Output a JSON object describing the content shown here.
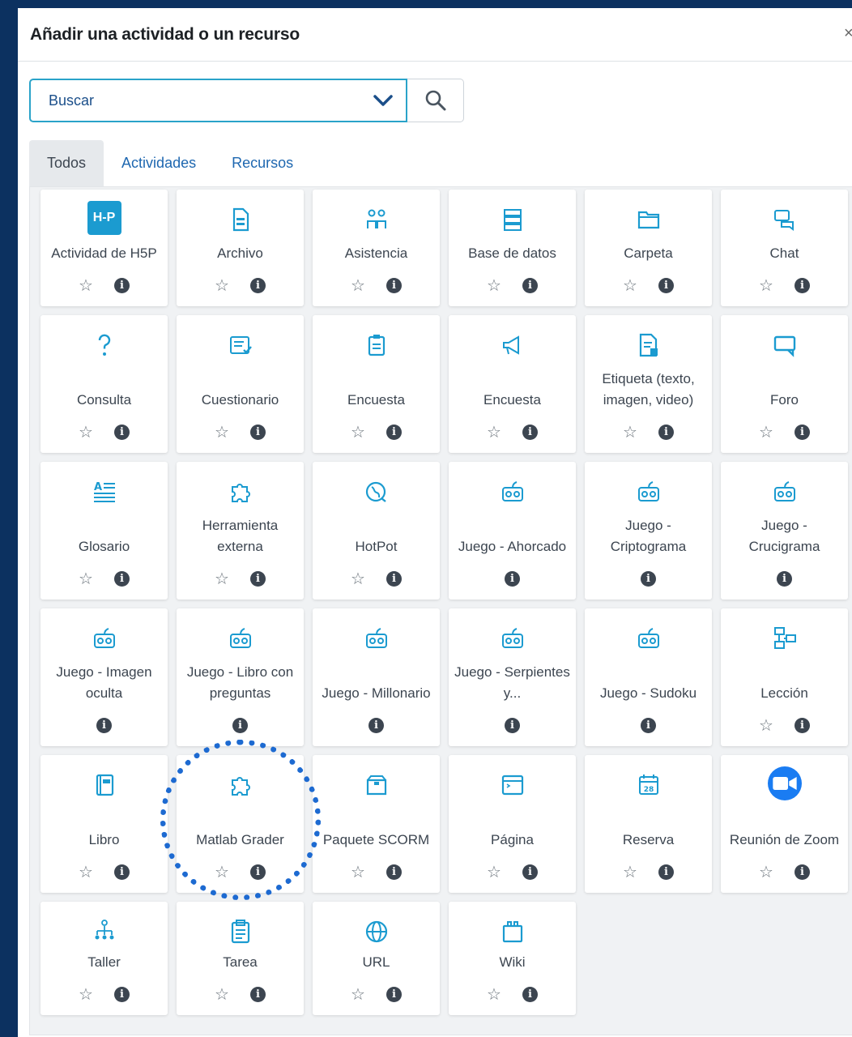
{
  "modal": {
    "title": "Añadir una actividad o un recurso",
    "close": "×"
  },
  "search": {
    "placeholder": "Buscar"
  },
  "tabs": [
    {
      "label": "Todos",
      "active": true
    },
    {
      "label": "Actividades",
      "active": false
    },
    {
      "label": "Recursos",
      "active": false
    }
  ],
  "items": [
    {
      "label": "Actividad de H5P",
      "icon": "h5p-icon",
      "starred": false
    },
    {
      "label": "Archivo",
      "icon": "file-icon",
      "starred": false
    },
    {
      "label": "Asistencia",
      "icon": "attendance-icon",
      "starred": false
    },
    {
      "label": "Base de datos",
      "icon": "database-icon",
      "starred": false
    },
    {
      "label": "Carpeta",
      "icon": "folder-icon",
      "starred": false
    },
    {
      "label": "Chat",
      "icon": "chat-icon",
      "starred": false
    },
    {
      "label": "Consulta",
      "icon": "question-icon",
      "starred": false
    },
    {
      "label": "Cuestionario",
      "icon": "quiz-icon",
      "starred": false
    },
    {
      "label": "Encuesta",
      "icon": "clipboard-icon",
      "starred": false
    },
    {
      "label": "Encuesta",
      "icon": "megaphone-icon",
      "starred": false
    },
    {
      "label": "Etiqueta (texto, imagen, video)",
      "icon": "label-icon",
      "starred": false
    },
    {
      "label": "Foro",
      "icon": "forum-icon",
      "starred": false
    },
    {
      "label": "Glosario",
      "icon": "glossary-icon",
      "starred": false
    },
    {
      "label": "Herramienta externa",
      "icon": "puzzle-icon",
      "starred": false
    },
    {
      "label": "HotPot",
      "icon": "hotpot-icon",
      "starred": false
    },
    {
      "label": "Juego - Ahorcado",
      "icon": "gamepad-icon",
      "no_star": true
    },
    {
      "label": "Juego - Criptograma",
      "icon": "gamepad-icon",
      "no_star": true
    },
    {
      "label": "Juego - Crucigrama",
      "icon": "gamepad-icon",
      "no_star": true
    },
    {
      "label": "Juego - Imagen oculta",
      "icon": "gamepad-icon",
      "no_star": true
    },
    {
      "label": "Juego - Libro con preguntas",
      "icon": "gamepad-icon",
      "no_star": true
    },
    {
      "label": "Juego - Millonario",
      "icon": "gamepad-icon",
      "no_star": true
    },
    {
      "label": "Juego - Serpientes y...",
      "icon": "gamepad-icon",
      "no_star": true
    },
    {
      "label": "Juego - Sudoku",
      "icon": "gamepad-icon",
      "no_star": true
    },
    {
      "label": "Lección",
      "icon": "lesson-icon",
      "starred": false
    },
    {
      "label": "Libro",
      "icon": "book-icon",
      "starred": false
    },
    {
      "label": "Matlab Grader",
      "icon": "puzzle-icon",
      "starred": false
    },
    {
      "label": "Paquete SCORM",
      "icon": "package-icon",
      "starred": false
    },
    {
      "label": "Página",
      "icon": "page-icon",
      "starred": false
    },
    {
      "label": "Reserva",
      "icon": "calendar-icon",
      "starred": false
    },
    {
      "label": "Reunión de Zoom",
      "icon": "zoom-icon",
      "starred": false
    },
    {
      "label": "Taller",
      "icon": "workshop-icon",
      "starred": false
    },
    {
      "label": "Tarea",
      "icon": "assignment-icon",
      "starred": false
    },
    {
      "label": "URL",
      "icon": "globe-icon",
      "starred": false
    },
    {
      "label": "Wiki",
      "icon": "wiki-icon",
      "starred": false
    }
  ],
  "colors": {
    "accent": "#1b9bd0",
    "header_bar": "#0c3160",
    "highlight_ring": "#1d6ad1"
  }
}
